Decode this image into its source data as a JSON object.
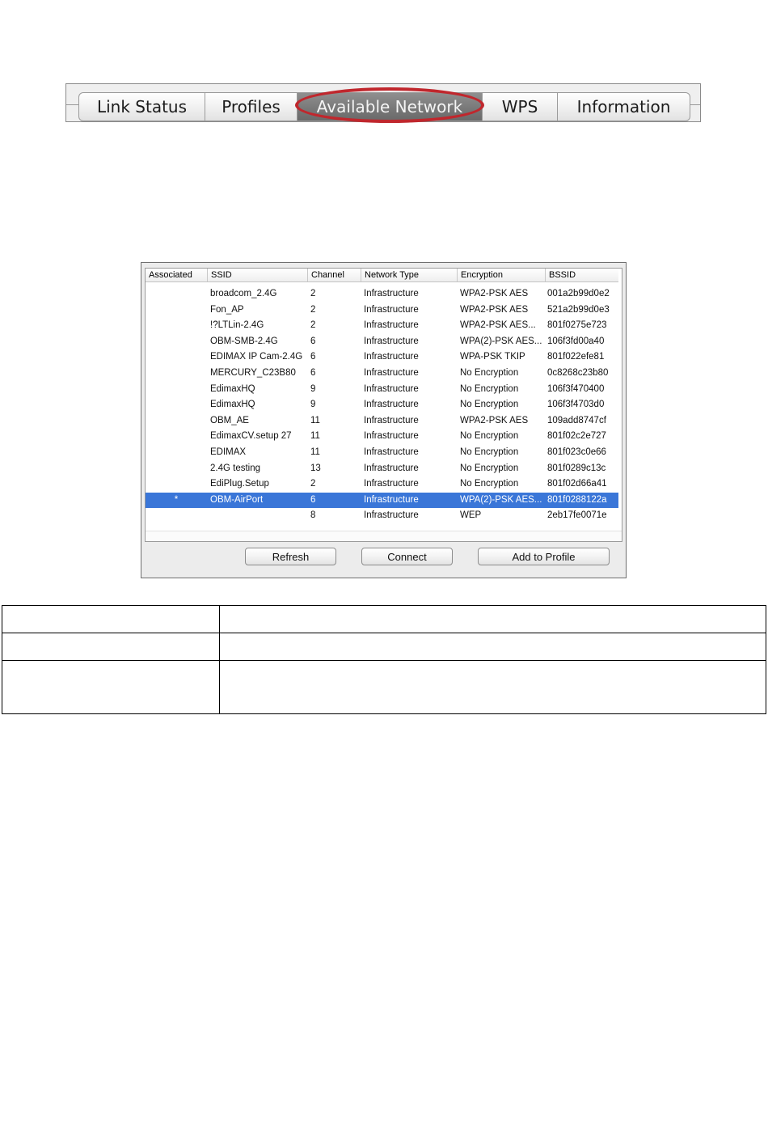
{
  "tabs": [
    {
      "label": "Link Status"
    },
    {
      "label": "Profiles"
    },
    {
      "label": "Available Network",
      "active": true
    },
    {
      "label": "WPS"
    },
    {
      "label": "Information"
    }
  ],
  "highlight_color": "#c0272d",
  "selection_color": "#3a76d8",
  "network_list": {
    "columns": [
      "Associated",
      "SSID",
      "Channel",
      "Network Type",
      "Encryption",
      "BSSID"
    ],
    "rows": [
      {
        "associated": "",
        "ssid": "broadcom_2.4G",
        "channel": "2",
        "type": "Infrastructure",
        "encryption": "WPA2-PSK AES",
        "bssid": "001a2b99d0e2"
      },
      {
        "associated": "",
        "ssid": "Fon_AP",
        "channel": "2",
        "type": "Infrastructure",
        "encryption": "WPA2-PSK AES",
        "bssid": "521a2b99d0e3"
      },
      {
        "associated": "",
        "ssid": "!?LTLin-2.4G",
        "channel": "2",
        "type": "Infrastructure",
        "encryption": "WPA2-PSK AES...",
        "bssid": "801f0275e723"
      },
      {
        "associated": "",
        "ssid": "OBM-SMB-2.4G",
        "channel": "6",
        "type": "Infrastructure",
        "encryption": "WPA(2)-PSK AES...",
        "bssid": "106f3fd00a40"
      },
      {
        "associated": "",
        "ssid": "EDIMAX IP Cam-2.4G",
        "channel": "6",
        "type": "Infrastructure",
        "encryption": "WPA-PSK TKIP",
        "bssid": "801f022efe81"
      },
      {
        "associated": "",
        "ssid": "MERCURY_C23B80",
        "channel": "6",
        "type": "Infrastructure",
        "encryption": "No Encryption",
        "bssid": "0c8268c23b80"
      },
      {
        "associated": "",
        "ssid": "EdimaxHQ",
        "channel": "9",
        "type": "Infrastructure",
        "encryption": "No Encryption",
        "bssid": "106f3f470400"
      },
      {
        "associated": "",
        "ssid": "EdimaxHQ",
        "channel": "9",
        "type": "Infrastructure",
        "encryption": "No Encryption",
        "bssid": "106f3f4703d0"
      },
      {
        "associated": "",
        "ssid": "OBM_AE",
        "channel": "11",
        "type": "Infrastructure",
        "encryption": "WPA2-PSK AES",
        "bssid": "109add8747cf"
      },
      {
        "associated": "",
        "ssid": "EdimaxCV.setup 27",
        "channel": "11",
        "type": "Infrastructure",
        "encryption": "No Encryption",
        "bssid": "801f02c2e727"
      },
      {
        "associated": "",
        "ssid": "EDIMAX",
        "channel": "11",
        "type": "Infrastructure",
        "encryption": "No Encryption",
        "bssid": "801f023c0e66"
      },
      {
        "associated": "",
        "ssid": "2.4G testing",
        "channel": "13",
        "type": "Infrastructure",
        "encryption": "No Encryption",
        "bssid": "801f0289c13c"
      },
      {
        "associated": "",
        "ssid": "EdiPlug.Setup",
        "channel": "2",
        "type": "Infrastructure",
        "encryption": "No Encryption",
        "bssid": "801f02d66a41"
      },
      {
        "associated": "*",
        "ssid": "OBM-AirPort",
        "channel": "6",
        "type": "Infrastructure",
        "encryption": "WPA(2)-PSK AES...",
        "bssid": "801f0288122a",
        "selected": true
      },
      {
        "associated": "",
        "ssid": "",
        "channel": "8",
        "type": "Infrastructure",
        "encryption": "WEP",
        "bssid": "2eb17fe0071e"
      }
    ]
  },
  "buttons": {
    "refresh": "Refresh",
    "connect": "Connect",
    "add_to_profile": "Add to Profile"
  }
}
